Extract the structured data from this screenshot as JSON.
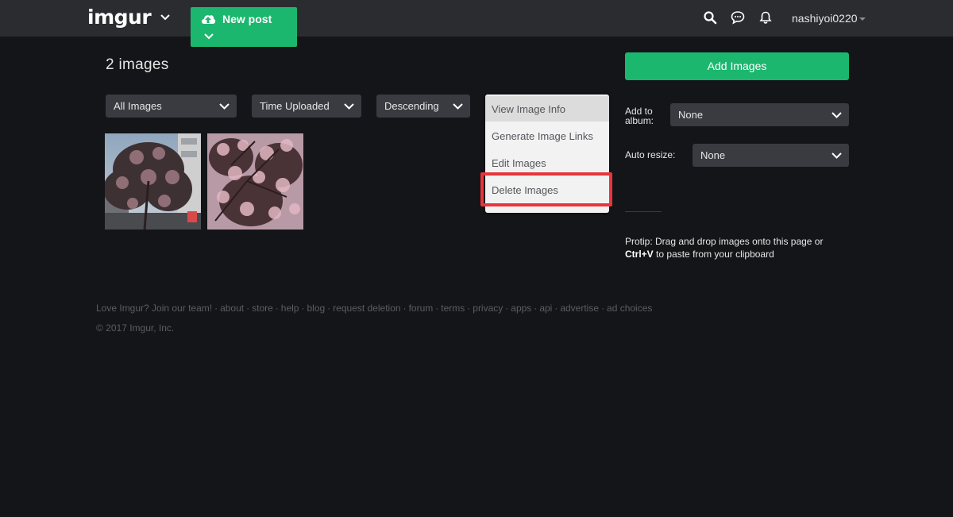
{
  "header": {
    "logo": "imgur",
    "new_post_label": "New post",
    "username": "nashiyoi0220"
  },
  "main": {
    "count_title": "2 images",
    "filters": [
      {
        "label": "All Images"
      },
      {
        "label": "Time Uploaded"
      },
      {
        "label": "Descending"
      }
    ],
    "dropdown": {
      "items": [
        {
          "label": "View Image Info"
        },
        {
          "label": "Generate Image Links"
        },
        {
          "label": "Edit Images"
        },
        {
          "label": "Delete Images"
        }
      ]
    }
  },
  "sidebar": {
    "add_images_label": "Add Images",
    "add_to_album_label": "Add to album:",
    "add_to_album_value": "None",
    "auto_resize_label": "Auto resize:",
    "auto_resize_value": "None",
    "protip_prefix": "Protip: Drag and drop images onto this page or",
    "protip_key": "Ctrl+V",
    "protip_suffix": "to paste from your clipboard"
  },
  "footer": {
    "links": [
      "Love Imgur? Join our team!",
      "about",
      "store",
      "help",
      "blog",
      "request deletion",
      "forum",
      "terms",
      "privacy",
      "apps",
      "api",
      "advertise",
      "ad choices"
    ],
    "separator": "·",
    "copyright": "© 2017 Imgur, Inc."
  },
  "colors": {
    "brand_green": "#1bb76e",
    "highlight_red": "#e8353b",
    "background": "#141518",
    "topbar": "#2b2c30"
  },
  "icons": {
    "logo_menu": "chevron-down-icon",
    "new_post": "cloud-upload-icon",
    "search": "search-icon",
    "messages": "chat-icon",
    "notifications": "bell-icon"
  }
}
